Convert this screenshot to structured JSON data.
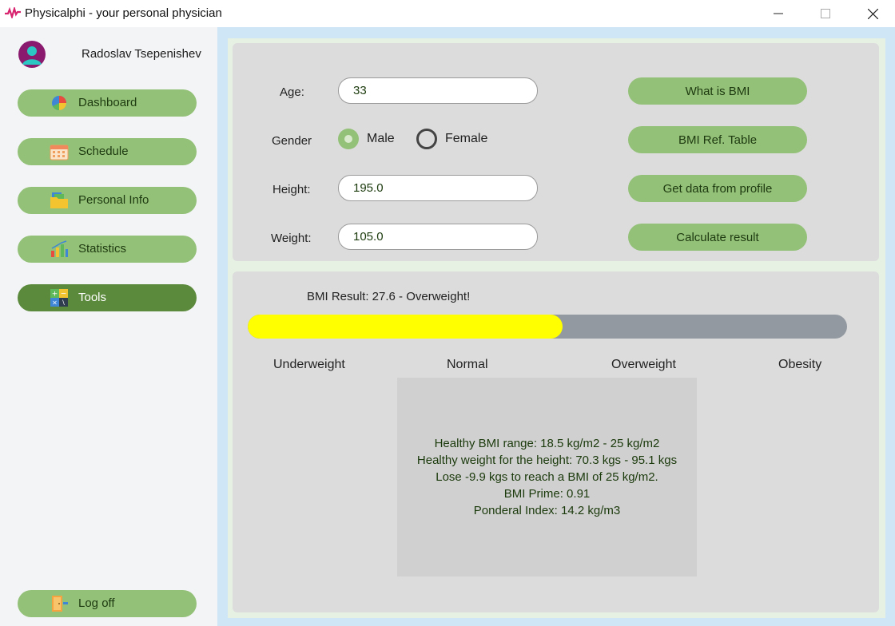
{
  "window": {
    "title": "Physicalphi - your personal physician"
  },
  "user": {
    "name": "Radoslav Tsepenishev"
  },
  "sidebar": {
    "items": [
      {
        "label": "Dashboard",
        "icon": "pie-chart-icon",
        "active": false
      },
      {
        "label": "Schedule",
        "icon": "calendar-icon",
        "active": false
      },
      {
        "label": "Personal Info",
        "icon": "folder-icon",
        "active": false
      },
      {
        "label": "Statistics",
        "icon": "bar-chart-icon",
        "active": false
      },
      {
        "label": "Tools",
        "icon": "calculator-icon",
        "active": true
      }
    ],
    "logoff": {
      "label": "Log off",
      "icon": "exit-door-icon"
    }
  },
  "form": {
    "age_label": "Age:",
    "age_value": "33",
    "gender_label": "Gender",
    "gender_options": [
      {
        "label": "Male",
        "selected": true
      },
      {
        "label": "Female",
        "selected": false
      }
    ],
    "height_label": "Height:",
    "height_value": "195.0",
    "weight_label": "Weight:",
    "weight_value": "105.0"
  },
  "actions": {
    "what_is_bmi": "What is BMI",
    "bmi_ref_table": "BMI Ref. Table",
    "get_profile": "Get data from profile",
    "calculate": "Calculate result"
  },
  "result": {
    "text": "BMI Result: 27.6 - Overweight!",
    "progress_fraction": 0.525,
    "scale": [
      "Underweight",
      "Normal",
      "Overweight",
      "Obesity"
    ],
    "details": [
      "Healthy BMI range: 18.5 kg/m2 - 25 kg/m2",
      "Healthy weight for the height: 70.3 kgs - 95.1 kgs",
      "Lose -9.9 kgs to reach a BMI of 25 kg/m2.",
      "BMI Prime: 0.91",
      "Ponderal Index: 14.2 kg/m3"
    ]
  },
  "colors": {
    "nav_button": "#93c178",
    "nav_active": "#5b8a3c",
    "progress_fill": "#ffff00",
    "progress_track": "#9299a0",
    "avatar_bg": "#8a1a6e"
  }
}
